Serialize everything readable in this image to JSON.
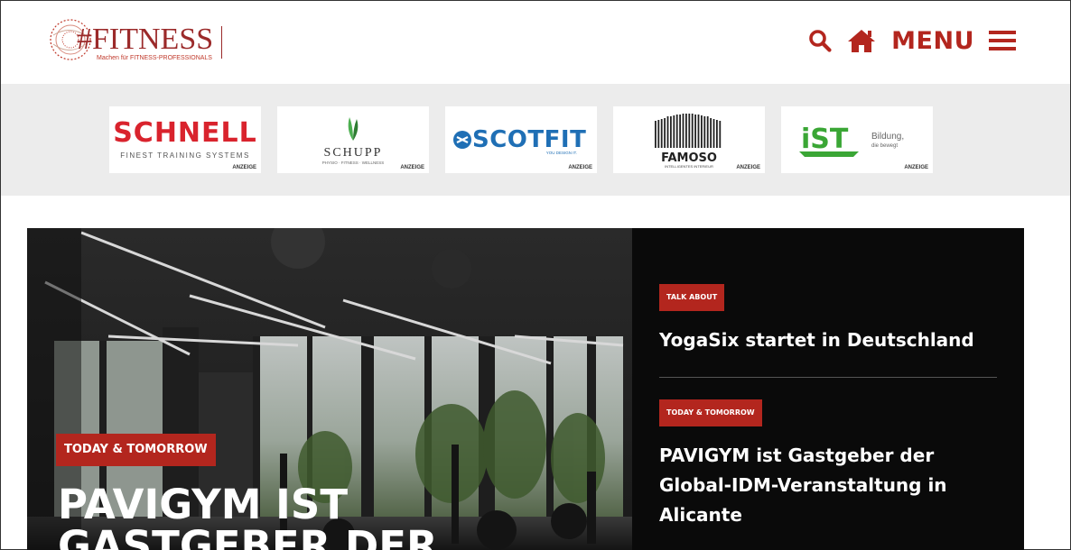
{
  "header": {
    "logo_title": "#FITNESS",
    "logo_subtitle": "Machen für FITNESS-PROFESSIONALS",
    "menu_label": "MENU"
  },
  "sponsors": [
    {
      "name": "SCHNELL",
      "tagline": "FINEST TRAINING SYSTEMS",
      "badge": "ANZEIGE"
    },
    {
      "name": "SCHUPP",
      "tagline": "PHYSIO · FITNESS · WELLNESS",
      "badge": "ANZEIGE"
    },
    {
      "name": "SCOTFIT",
      "tagline": "YOU DESIGN IT.",
      "badge": "ANZEIGE"
    },
    {
      "name": "FAMOSO",
      "tagline": "INTELLIGENTES INTERIEUR",
      "badge": "ANZEIGE"
    },
    {
      "name": "iST",
      "tagline": "Bildung,",
      "tagline2": "die bewegt",
      "badge": "ANZEIGE"
    }
  ],
  "hero": {
    "main": {
      "category": "TODAY & TOMORROW",
      "title_line1": "PAVIGYM IST",
      "title_line2": "GASTGEBER DER"
    },
    "side": [
      {
        "category": "TALK ABOUT",
        "title": "YogaSix startet in Deutschland"
      },
      {
        "category": "TODAY & TOMORROW",
        "title_line1": "PAVIGYM ist Gastgeber der",
        "title_line2": "Global-IDM-Veranstaltung in",
        "title_line3": "Alicante"
      }
    ]
  },
  "colors": {
    "brand": "#b3261e",
    "strip": "#ececec",
    "hero_bg": "#0a0a0a"
  }
}
